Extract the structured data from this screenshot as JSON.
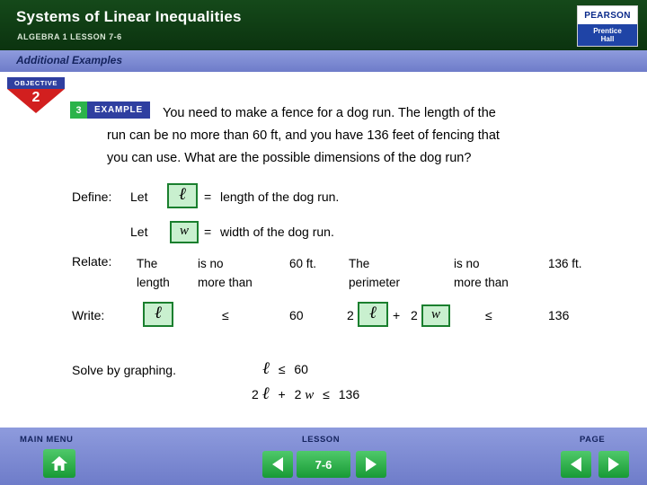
{
  "header": {
    "title": "Systems of Linear Inequalities",
    "subtitle": "ALGEBRA 1   LESSON 7-6",
    "logo_top": "PEARSON",
    "logo_bottom_line1": "Prentice",
    "logo_bottom_line2": "Hall"
  },
  "band": {
    "label": "Additional Examples"
  },
  "objective": {
    "label": "OBJECTIVE",
    "number": "2"
  },
  "example": {
    "number": "3",
    "word": "EXAMPLE"
  },
  "problem": {
    "line1": "You need to make a fence for a dog run. The length of the",
    "line2": "run can be no more than 60 ft, and you have 136 feet of fencing that",
    "line3": "you can use. What are the possible dimensions of the dog run?"
  },
  "define": {
    "label": "Define:",
    "let1": "Let",
    "var1": "ℓ",
    "eq1": "=",
    "desc1": "length of the dog run.",
    "let2": "Let",
    "var2": "w",
    "eq2": "=",
    "desc2": "width of the dog run."
  },
  "relate": {
    "label": "Relate:",
    "col1_line1": "The",
    "col1_line2": "length",
    "col2_line1": "is no",
    "col2_line2": "more than",
    "col3": "60 ft.",
    "col4_line1": "The",
    "col4_line2": "perimeter",
    "col5_line1": "is no",
    "col5_line2": "more than",
    "col6": "136 ft."
  },
  "write": {
    "label": "Write:",
    "var_l": "ℓ",
    "op1": "≤",
    "val1": "60",
    "coef2": "2",
    "var_l2": "ℓ",
    "plus": "+",
    "coef_w": "2",
    "var_w": "w",
    "op2": "≤",
    "val2": "136"
  },
  "solve": {
    "label": "Solve by graphing.",
    "ineq1_var": "ℓ",
    "ineq1_op": "≤",
    "ineq1_val": "60",
    "ineq2_coef": "2",
    "ineq2_var": "ℓ",
    "ineq2_plus": "+",
    "ineq2_coef2": "2",
    "ineq2_var2": "w",
    "ineq2_op": "≤",
    "ineq2_val": "136"
  },
  "footer": {
    "main_menu": "MAIN MENU",
    "lesson": "LESSON",
    "page": "PAGE",
    "lesson_number": "7-6",
    "home_icon": "home-icon",
    "prev_icon": "triangle-left-icon",
    "next_icon": "triangle-right-icon"
  }
}
